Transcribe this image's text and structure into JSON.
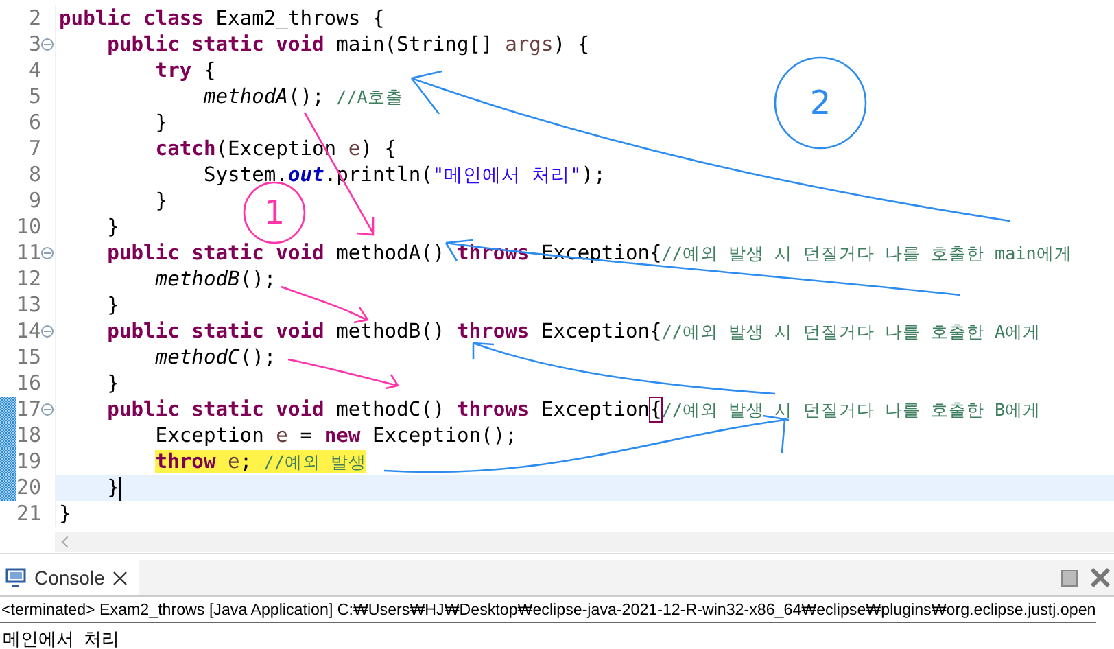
{
  "editor": {
    "lines": [
      {
        "number": "2",
        "fold": false,
        "changed": false,
        "current": false,
        "highlighted": false,
        "tokens": [
          {
            "kind": "kw",
            "text": "public class"
          },
          {
            "kind": "plain",
            "text": " Exam2_throws {"
          }
        ]
      },
      {
        "number": "3",
        "fold": true,
        "changed": false,
        "current": false,
        "highlighted": false,
        "tokens": [
          {
            "kind": "kw",
            "text": "    public static void"
          },
          {
            "kind": "plain",
            "text": " main(String[] "
          },
          {
            "kind": "param",
            "text": "args"
          },
          {
            "kind": "plain",
            "text": ") {"
          }
        ]
      },
      {
        "number": "4",
        "fold": false,
        "changed": false,
        "current": false,
        "highlighted": false,
        "tokens": [
          {
            "kind": "kw",
            "text": "        try"
          },
          {
            "kind": "plain",
            "text": " {"
          }
        ]
      },
      {
        "number": "5",
        "fold": false,
        "changed": false,
        "current": false,
        "highlighted": false,
        "tokens": [
          {
            "kind": "call",
            "text": "            methodA"
          },
          {
            "kind": "plain",
            "text": "(); "
          },
          {
            "kind": "comment",
            "text": "//A호출"
          }
        ]
      },
      {
        "number": "6",
        "fold": false,
        "changed": false,
        "current": false,
        "highlighted": false,
        "tokens": [
          {
            "kind": "plain",
            "text": "        }"
          }
        ]
      },
      {
        "number": "7",
        "fold": false,
        "changed": false,
        "current": false,
        "highlighted": false,
        "tokens": [
          {
            "kind": "kw",
            "text": "        catch"
          },
          {
            "kind": "plain",
            "text": "(Exception "
          },
          {
            "kind": "param",
            "text": "e"
          },
          {
            "kind": "plain",
            "text": ") {"
          }
        ]
      },
      {
        "number": "8",
        "fold": false,
        "changed": false,
        "current": false,
        "highlighted": false,
        "tokens": [
          {
            "kind": "plain",
            "text": "            System."
          },
          {
            "kind": "field",
            "text": "out"
          },
          {
            "kind": "plain",
            "text": ".println("
          },
          {
            "kind": "string",
            "text": "\"메인에서 처리\""
          },
          {
            "kind": "plain",
            "text": ");"
          }
        ]
      },
      {
        "number": "9",
        "fold": false,
        "changed": false,
        "current": false,
        "highlighted": false,
        "tokens": [
          {
            "kind": "plain",
            "text": "        }"
          }
        ]
      },
      {
        "number": "10",
        "fold": false,
        "changed": false,
        "current": false,
        "highlighted": false,
        "tokens": [
          {
            "kind": "plain",
            "text": "    }"
          }
        ]
      },
      {
        "number": "11",
        "fold": true,
        "changed": false,
        "current": false,
        "highlighted": false,
        "tokens": [
          {
            "kind": "kw",
            "text": "    public static void"
          },
          {
            "kind": "plain",
            "text": " methodA() "
          },
          {
            "kind": "kw",
            "text": "throws"
          },
          {
            "kind": "plain",
            "text": " Exception{"
          },
          {
            "kind": "comment",
            "text": "//예외 발생 시 던질거다 나를 호출한 main에게"
          }
        ]
      },
      {
        "number": "12",
        "fold": false,
        "changed": false,
        "current": false,
        "highlighted": false,
        "tokens": [
          {
            "kind": "call",
            "text": "        methodB"
          },
          {
            "kind": "plain",
            "text": "();"
          }
        ]
      },
      {
        "number": "13",
        "fold": false,
        "changed": false,
        "current": false,
        "highlighted": false,
        "tokens": [
          {
            "kind": "plain",
            "text": "    }"
          }
        ]
      },
      {
        "number": "14",
        "fold": true,
        "changed": false,
        "current": false,
        "highlighted": false,
        "tokens": [
          {
            "kind": "kw",
            "text": "    public static void"
          },
          {
            "kind": "plain",
            "text": " methodB() "
          },
          {
            "kind": "kw",
            "text": "throws"
          },
          {
            "kind": "plain",
            "text": " Exception{"
          },
          {
            "kind": "comment",
            "text": "//예외 발생 시 던질거다 나를 호출한 A에게"
          }
        ]
      },
      {
        "number": "15",
        "fold": false,
        "changed": false,
        "current": false,
        "highlighted": false,
        "tokens": [
          {
            "kind": "call",
            "text": "        methodC"
          },
          {
            "kind": "plain",
            "text": "();"
          }
        ]
      },
      {
        "number": "16",
        "fold": false,
        "changed": false,
        "current": false,
        "highlighted": false,
        "tokens": [
          {
            "kind": "plain",
            "text": "    }"
          }
        ]
      },
      {
        "number": "17",
        "fold": true,
        "changed": true,
        "current": false,
        "highlighted": false,
        "tokens": [
          {
            "kind": "kw",
            "text": "    public static void"
          },
          {
            "kind": "plain",
            "text": " methodC() "
          },
          {
            "kind": "kw",
            "text": "throws"
          },
          {
            "kind": "plain",
            "text": " Exception"
          },
          {
            "kind": "bracket",
            "text": "{"
          },
          {
            "kind": "comment",
            "text": "//예외 발생 시 던질거다 나를 호출한 B에게"
          }
        ]
      },
      {
        "number": "18",
        "fold": false,
        "changed": true,
        "current": false,
        "highlighted": false,
        "tokens": [
          {
            "kind": "plain",
            "text": "        Exception "
          },
          {
            "kind": "param",
            "text": "e"
          },
          {
            "kind": "plain",
            "text": " = "
          },
          {
            "kind": "kw",
            "text": "new"
          },
          {
            "kind": "plain",
            "text": " Exception();"
          }
        ]
      },
      {
        "number": "19",
        "fold": false,
        "changed": true,
        "current": false,
        "highlighted": true,
        "tokens": [
          {
            "kind": "kw",
            "text": "        throw "
          },
          {
            "kind": "param",
            "text": "e"
          },
          {
            "kind": "plain",
            "text": "; "
          },
          {
            "kind": "comment",
            "text": "//예외 발생"
          }
        ]
      },
      {
        "number": "20",
        "fold": false,
        "changed": true,
        "current": true,
        "highlighted": false,
        "tokens": [
          {
            "kind": "plain",
            "text": "    }"
          }
        ]
      },
      {
        "number": "21",
        "fold": false,
        "changed": false,
        "current": false,
        "highlighted": false,
        "tokens": [
          {
            "kind": "plain",
            "text": "}"
          }
        ]
      }
    ]
  },
  "annotations": [
    {
      "label": "1",
      "kind": "pink"
    },
    {
      "label": "2",
      "kind": "blue"
    }
  ],
  "console": {
    "tab": {
      "label": "Console",
      "selected": true
    },
    "status": "<terminated> Exam2_throws [Java Application] C:₩Users₩HJ₩Desktop₩eclipse-java-2021-12-R-win32-x86_64₩eclipse₩plugins₩org.eclipse.justj.open",
    "output": [
      "메인에서  처리"
    ]
  }
}
